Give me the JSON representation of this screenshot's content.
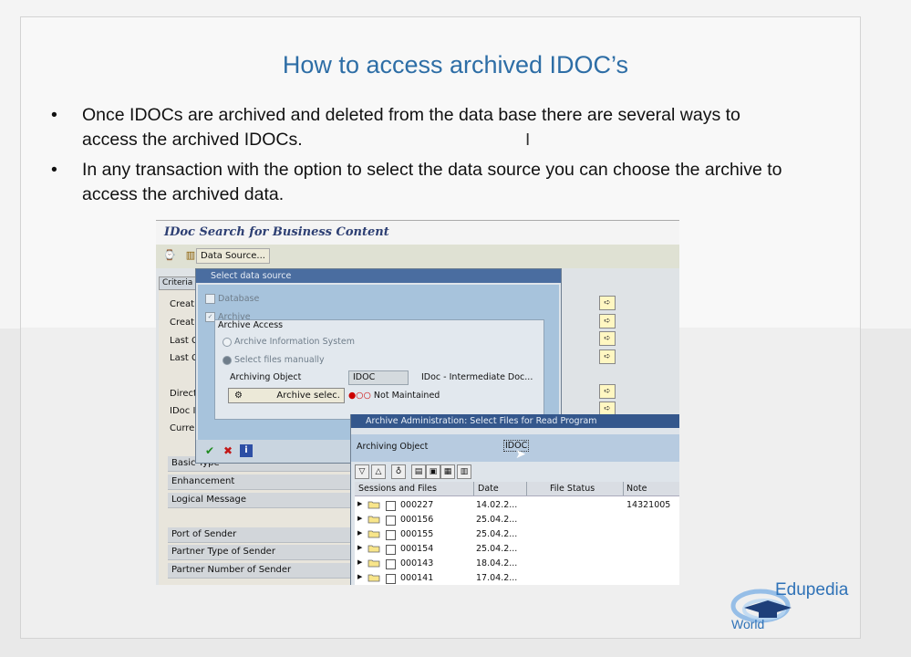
{
  "slide": {
    "title": "How to access archived IDOC’s",
    "bullets": [
      {
        "marker": "•",
        "text": "Once IDOCs are archived and deleted from the data base there are several ways to access the archived IDOCs."
      },
      {
        "marker": "•",
        "text": "In any transaction with the option to select the data source you can choose the archive to access the archived data."
      }
    ]
  },
  "sap": {
    "window_title": "IDoc Search for Business Content",
    "toolbar": {
      "data_source_label": "Data Source..."
    },
    "criteria": {
      "tab_label": "Criteria",
      "rows_partial": [
        "Creat",
        "Creat",
        "Last C",
        "Last C",
        "Direct",
        "IDoc I",
        "Currer"
      ],
      "fields": [
        "Basic Type",
        "Enhancement",
        "Logical Message",
        "Port of Sender",
        "Partner Type of Sender",
        "Partner Number of Sender"
      ]
    },
    "select_data_source": {
      "title": "Select data source",
      "database_label": "Database",
      "archive_label": "Archive",
      "group_title": "Archive Access",
      "radio_ais": "Archive Information System",
      "radio_manual": "Select files manually",
      "archiving_object_label": "Archiving Object",
      "archiving_object_value": "IDOC",
      "archiving_object_desc": "IDoc - Intermediate Doc...",
      "archive_select_button": "Archive selec.",
      "status_text": "Not Maintained"
    },
    "archive_admin": {
      "title": "Archive Administration: Select Files for Read Program",
      "archiving_object_label": "Archiving Object",
      "archiving_object_value": "IDOC",
      "columns": [
        "Sessions and Files",
        "Date",
        "File Status",
        "Note"
      ],
      "rows": [
        {
          "session": "000227",
          "date": "14.02.2...",
          "note": "14321005"
        },
        {
          "session": "000156",
          "date": "25.04.2...",
          "note": ""
        },
        {
          "session": "000155",
          "date": "25.04.2...",
          "note": ""
        },
        {
          "session": "000154",
          "date": "25.04.2...",
          "note": ""
        },
        {
          "session": "000143",
          "date": "18.04.2...",
          "note": ""
        },
        {
          "session": "000141",
          "date": "17.04.2...",
          "note": ""
        }
      ]
    }
  },
  "logo": {
    "name": "Edupedia",
    "sub": "World"
  },
  "colors": {
    "title_blue": "#2e6ea6",
    "sap_title_blue": "#2d3f73",
    "dialog_titlebar": "#4a6da0",
    "logo_blue": "#2f72b7"
  }
}
